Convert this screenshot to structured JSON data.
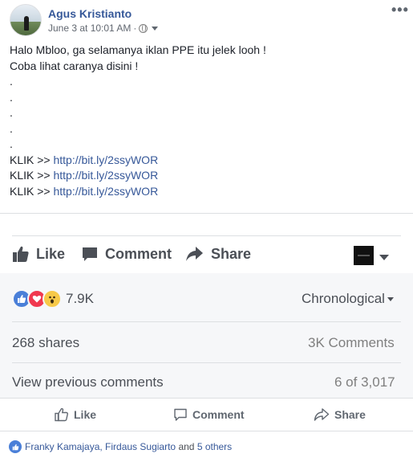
{
  "post": {
    "author": "Agus Kristianto",
    "timestamp": "June 3 at 10:01 AM",
    "separator": "·",
    "lines": [
      "Halo Mbloo, ga selamanya iklan PPE itu jelek looh !",
      "Coba lihat caranya disini !",
      ".",
      ".",
      ".",
      ".",
      "."
    ],
    "klik_prefix": "KLIK >>",
    "links": [
      "http://bit.ly/2ssyWOR",
      "http://bit.ly/2ssyWOR",
      "http://bit.ly/2ssyWOR"
    ],
    "more_label": "•••"
  },
  "action_bar": {
    "like": "Like",
    "comment": "Comment",
    "share": "Share"
  },
  "summary": {
    "reaction_count": "7.9K",
    "sort_label": "Chronological",
    "shares": "268 shares",
    "comments": "3K Comments",
    "view_previous": "View previous comments",
    "comment_position": "6 of 3,017"
  },
  "bottom_actions": {
    "like": "Like",
    "comment": "Comment",
    "share": "Share"
  },
  "likers": {
    "names": "Franky Kamajaya, Firdaus Sugiarto",
    "connector": "and",
    "others": "5 others"
  },
  "colors": {
    "link_blue": "#365899",
    "like_blue": "#4a7fd8",
    "love_red": "#f0384f",
    "wow_yellow": "#f7c948",
    "panel_gray": "#f6f7f9"
  },
  "icons": [
    "avatar",
    "globe-icon",
    "more-options-icon",
    "thumbs-up-icon",
    "comment-icon",
    "share-icon",
    "page-selector-icon",
    "like-reaction-icon",
    "love-reaction-icon",
    "wow-reaction-icon"
  ]
}
